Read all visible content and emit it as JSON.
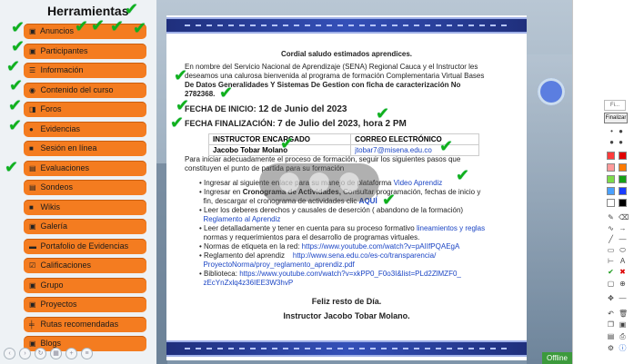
{
  "sidebar": {
    "title": "Herramientas",
    "items": [
      {
        "label": "Anuncios",
        "icon": "megaphone-icon",
        "glyph": "🔊"
      },
      {
        "label": "Participantes",
        "icon": "users-icon",
        "glyph": "👥"
      },
      {
        "label": "Información",
        "icon": "list-icon",
        "glyph": "☰"
      },
      {
        "label": "Contenido del curso",
        "icon": "book-icon",
        "glyph": "📘"
      },
      {
        "label": "Foros",
        "icon": "forum-icon",
        "glyph": "💬"
      },
      {
        "label": "Evidencias",
        "icon": "info-icon",
        "glyph": "❗"
      },
      {
        "label": "Sesión en línea",
        "icon": "video-icon",
        "glyph": "🎥"
      },
      {
        "label": "Evaluaciones",
        "icon": "checklist-icon",
        "glyph": "📋"
      },
      {
        "label": "Sondeos",
        "icon": "poll-icon",
        "glyph": "📋"
      },
      {
        "label": "Wikis",
        "icon": "bookmark-icon",
        "glyph": "🔖"
      },
      {
        "label": "Galería",
        "icon": "image-icon",
        "glyph": "🖼"
      },
      {
        "label": "Portafolio de Evidencias",
        "icon": "briefcase-icon",
        "glyph": "💼"
      },
      {
        "label": "Calificaciones",
        "icon": "grades-icon",
        "glyph": "✅"
      },
      {
        "label": "Grupo",
        "icon": "group-icon",
        "glyph": "👥"
      },
      {
        "label": "Proyectos",
        "icon": "projects-icon",
        "glyph": "📁"
      },
      {
        "label": "Rutas recomendadas",
        "icon": "route-icon",
        "glyph": "➗"
      },
      {
        "label": "Blogs",
        "icon": "blog-icon",
        "glyph": "📰"
      }
    ]
  },
  "document": {
    "greeting": "Cordial saludo estimados aprendices.",
    "intro_1": "En nombre del Servicio Nacional de Aprendizaje (SENA) Regional Cauca y el Instructor les",
    "intro_2": "deseamos una calurosa bienvenida al programa de formación Complementaria Virtual Bases",
    "intro_3": "De Datos Generalidades Y Sistemas De Gestion con ficha de caracterización No",
    "intro_4": "2782368.",
    "start_label": "FECHA DE INICIO:",
    "start_value": "12 de Junio del 2023",
    "end_label": "FECHA FINALIZACIÓN:",
    "end_value": "7 de Julio del 2023, hora 2 PM",
    "table_headers": [
      "INSTRUCTOR ENCARGADO",
      "CORREO ELECTRÓNICO"
    ],
    "instructor_name": "Jacobo Tobar Molano",
    "instructor_email": "jtobar7@misena.edu.co",
    "steps_intro_1": "Para iniciar adecuadamente el proceso de formación, seguir los siguientes pasos que",
    "steps_intro_2": "constituyen el punto de partida para su formación",
    "bullet_1a": "Ingresar al siguiente enlace para su manejo de plataforma",
    "bullet_1b": "Video Aprendiz",
    "bullet_2a": "Ingresar en",
    "bullet_2b": "Cronograma de Actividades,",
    "bullet_2c": "Consultar programación, fechas de inicio y",
    "bullet_2d": "fin, descargar el cronograma de actividades clic",
    "bullet_2e": "AQUÍ",
    "bullet_3a": "Leer los deberes derechos y causales de deserción ( abandono de la formación)",
    "bullet_3b": "Reglamento al Aprendiz",
    "bullet_4a": "Leer detalladamente y tener en cuenta para su proceso formativo",
    "bullet_4b": "lineamientos y reglas",
    "bullet_4c": "normas y requerimientos para el desarrollo de programas virtuales.",
    "bullet_5a": "Normas de etiqueta en la red:",
    "bullet_5b": "https://www.youtube.com/watch?v=pAIIfPQAEgA",
    "bullet_6a": "Reglamento del aprendiz",
    "bullet_6b": "http://www.sena.edu.co/es-co/transparencia/",
    "bullet_6c": "ProyectoNorma/proy_reglamento_aprendiz.pdf",
    "bullet_7a": "Biblioteca:",
    "bullet_7b": "https://www.youtube.com/watch?v=xkPP0_F0o3I&list=PLd2ZlMZF0_",
    "bullet_7c": "zEcYnZxlq4z36IEE3W3hvP",
    "closing_1": "Feliz resto de Día.",
    "closing_2": "Instructor Jacobo Tobar Molano."
  },
  "palette": {
    "tab_label": "Fi...",
    "finalizar": "Finalizar",
    "colors": [
      "#ff3b3b",
      "#e00000",
      "#ff9a9a",
      "#ff7a00",
      "#7ddc4a",
      "#16a016",
      "#4aa0ff",
      "#1a3cff",
      "#ffffff",
      "#000000"
    ]
  },
  "footer": {
    "online_label": "Offline"
  }
}
